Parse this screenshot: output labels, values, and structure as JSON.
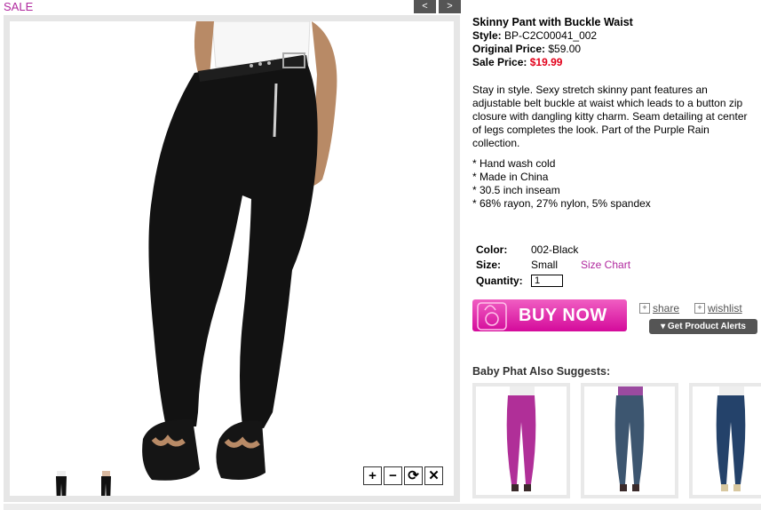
{
  "header": {
    "sale_label": "SALE",
    "prev_label": "<",
    "next_label": ">"
  },
  "product": {
    "name": "Skinny Pant with Buckle Waist",
    "style_label": "Style:",
    "style_value": "BP-C2C00041_002",
    "original_price_label": "Original Price:",
    "original_price_value": "$59.00",
    "sale_price_label": "Sale Price:",
    "sale_price_value": "$19.99",
    "description": "Stay in style. Sexy stretch skinny pant features an adjustable belt buckle at waist which leads to a button zip closure with dangling kitty charm. Seam detailing at center of legs completes the look. Part of the Purple Rain collection.",
    "bullets": [
      "* Hand wash cold",
      "* Made in China",
      "* 30.5 inch inseam",
      "* 68% rayon, 27% nylon, 5% spandex"
    ]
  },
  "options": {
    "color_label": "Color:",
    "color_value": "002-Black",
    "size_label": "Size:",
    "size_value": "Small",
    "size_chart_label": "Size Chart",
    "quantity_label": "Quantity:",
    "quantity_value": "1"
  },
  "actions": {
    "buy_now": "BUY NOW",
    "share": "share",
    "wishlist": "wishlist",
    "product_alerts": "Get Product Alerts"
  },
  "zoom": {
    "zoom_in": "+",
    "zoom_out": "−",
    "rotate": "⟳",
    "fullscreen": "✕"
  },
  "suggestions": {
    "title": "Baby Phat Also Suggests:"
  },
  "colors": {
    "accent": "#b0289e",
    "sale_red": "#e2001a",
    "buy_pink": "#e0289f"
  }
}
